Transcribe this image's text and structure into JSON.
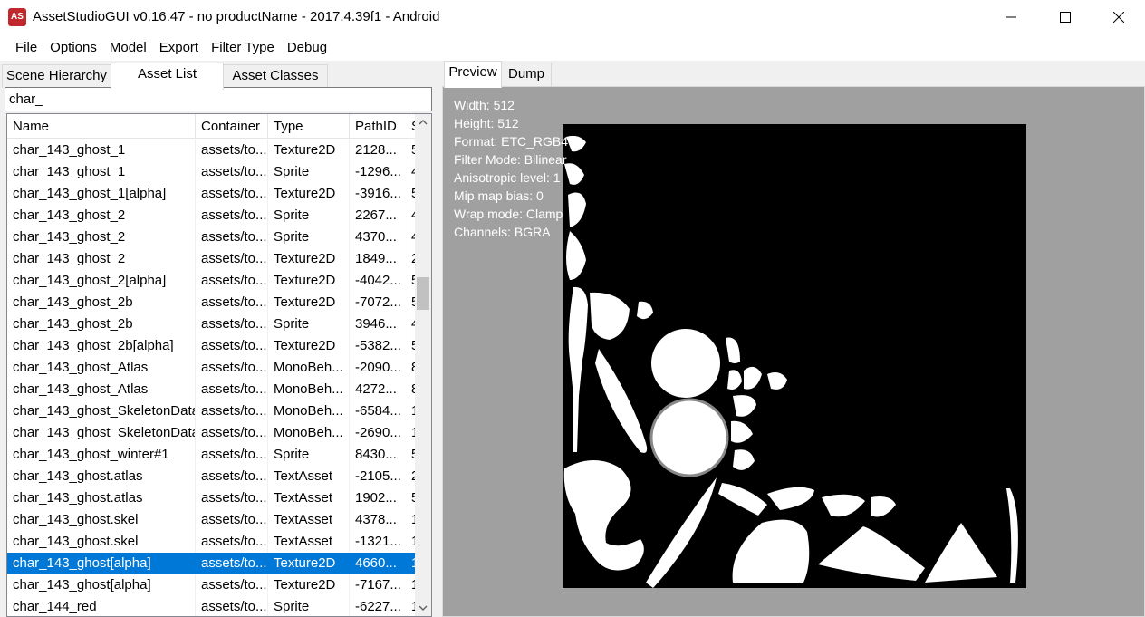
{
  "window": {
    "title": "AssetStudioGUI v0.16.47 - no productName - 2017.4.39f1 - Android",
    "icon_label": "AS"
  },
  "menu": [
    "File",
    "Options",
    "Model",
    "Export",
    "Filter Type",
    "Debug"
  ],
  "left_tabs": [
    {
      "label": "Scene Hierarchy",
      "active": false
    },
    {
      "label": "Asset List",
      "active": true
    },
    {
      "label": "Asset Classes",
      "active": false
    }
  ],
  "search": {
    "value": "char_"
  },
  "columns": [
    "Name",
    "Container",
    "Type",
    "PathID",
    "S"
  ],
  "rows": [
    {
      "name": "char_143_ghost_1",
      "container": "assets/to...",
      "type": "Texture2D",
      "pathid": "2128...",
      "size": "5"
    },
    {
      "name": "char_143_ghost_1",
      "container": "assets/to...",
      "type": "Sprite",
      "pathid": "-1296...",
      "size": "4"
    },
    {
      "name": "char_143_ghost_1[alpha]",
      "container": "assets/to...",
      "type": "Texture2D",
      "pathid": "-3916...",
      "size": "5"
    },
    {
      "name": "char_143_ghost_2",
      "container": "assets/to...",
      "type": "Sprite",
      "pathid": "2267...",
      "size": "4"
    },
    {
      "name": "char_143_ghost_2",
      "container": "assets/to...",
      "type": "Sprite",
      "pathid": "4370...",
      "size": "4"
    },
    {
      "name": "char_143_ghost_2",
      "container": "assets/to...",
      "type": "Texture2D",
      "pathid": "1849...",
      "size": "2"
    },
    {
      "name": "char_143_ghost_2[alpha]",
      "container": "assets/to...",
      "type": "Texture2D",
      "pathid": "-4042...",
      "size": "5"
    },
    {
      "name": "char_143_ghost_2b",
      "container": "assets/to...",
      "type": "Texture2D",
      "pathid": "-7072...",
      "size": "5"
    },
    {
      "name": "char_143_ghost_2b",
      "container": "assets/to...",
      "type": "Sprite",
      "pathid": "3946...",
      "size": "4"
    },
    {
      "name": "char_143_ghost_2b[alpha]",
      "container": "assets/to...",
      "type": "Texture2D",
      "pathid": "-5382...",
      "size": "5"
    },
    {
      "name": "char_143_ghost_Atlas",
      "container": "assets/to...",
      "type": "MonoBeh...",
      "pathid": "-2090...",
      "size": "8"
    },
    {
      "name": "char_143_ghost_Atlas",
      "container": "assets/to...",
      "type": "MonoBeh...",
      "pathid": "4272...",
      "size": "8"
    },
    {
      "name": "char_143_ghost_SkeletonData",
      "container": "assets/to...",
      "type": "MonoBeh...",
      "pathid": "-6584...",
      "size": "1"
    },
    {
      "name": "char_143_ghost_SkeletonData",
      "container": "assets/to...",
      "type": "MonoBeh...",
      "pathid": "-2690...",
      "size": "1"
    },
    {
      "name": "char_143_ghost_winter#1",
      "container": "assets/to...",
      "type": "Sprite",
      "pathid": "8430...",
      "size": "5"
    },
    {
      "name": "char_143_ghost.atlas",
      "container": "assets/to...",
      "type": "TextAsset",
      "pathid": "-2105...",
      "size": "2"
    },
    {
      "name": "char_143_ghost.atlas",
      "container": "assets/to...",
      "type": "TextAsset",
      "pathid": "1902...",
      "size": "5"
    },
    {
      "name": "char_143_ghost.skel",
      "container": "assets/to...",
      "type": "TextAsset",
      "pathid": "4378...",
      "size": "1"
    },
    {
      "name": "char_143_ghost.skel",
      "container": "assets/to...",
      "type": "TextAsset",
      "pathid": "-1321...",
      "size": "1"
    },
    {
      "name": "char_143_ghost[alpha]",
      "container": "assets/to...",
      "type": "Texture2D",
      "pathid": "4660...",
      "size": "1",
      "selected": true
    },
    {
      "name": "char_143_ghost[alpha]",
      "container": "assets/to...",
      "type": "Texture2D",
      "pathid": "-7167...",
      "size": "1"
    },
    {
      "name": "char_144_red",
      "container": "assets/to...",
      "type": "Sprite",
      "pathid": "-6227...",
      "size": "1"
    }
  ],
  "right_tabs": [
    {
      "label": "Preview",
      "active": true
    },
    {
      "label": "Dump",
      "active": false
    }
  ],
  "preview_info": [
    "Width: 512",
    "Height: 512",
    "Format: ETC_RGB4",
    "Filter Mode: Bilinear",
    "Anisotropic level: 1",
    "Mip map bias: 0",
    "Wrap mode: Clamp",
    "Channels: BGRA"
  ],
  "colors": {
    "selection": "#0078d7",
    "preview_bg": "#a0a0a0",
    "texture_bg": "#000000"
  }
}
